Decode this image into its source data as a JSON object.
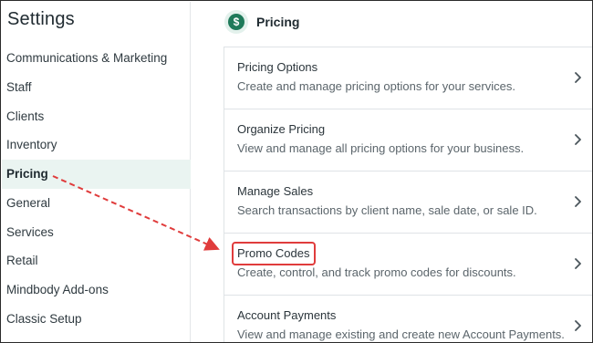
{
  "sidebar": {
    "title": "Settings",
    "items": [
      {
        "label": "Communications & Marketing"
      },
      {
        "label": "Staff"
      },
      {
        "label": "Clients"
      },
      {
        "label": "Inventory"
      },
      {
        "label": "Pricing",
        "active": true
      },
      {
        "label": "General"
      },
      {
        "label": "Services"
      },
      {
        "label": "Retail"
      },
      {
        "label": "Mindbody Add-ons"
      },
      {
        "label": "Classic Setup"
      }
    ]
  },
  "main": {
    "section_icon": "dollar-icon",
    "section_title": "Pricing",
    "cards": [
      {
        "title": "Pricing Options",
        "description": "Create and manage pricing options for your services."
      },
      {
        "title": "Organize Pricing",
        "description": "View and manage all pricing options for your business."
      },
      {
        "title": "Manage Sales",
        "description": "Search transactions by client name, sale date, or sale ID."
      },
      {
        "title": "Promo Codes",
        "description": "Create, control, and track promo codes for discounts.",
        "highlighted": true
      },
      {
        "title": "Account Payments",
        "description": "View and manage existing and create new Account Payments."
      }
    ]
  },
  "annotation": {
    "from": "Pricing",
    "to": "Promo Codes",
    "color": "#e03c3c"
  },
  "colors": {
    "accent_green": "#1f7a5a",
    "active_bg": "#eaf4f1",
    "highlight_red": "#e03c3c"
  }
}
